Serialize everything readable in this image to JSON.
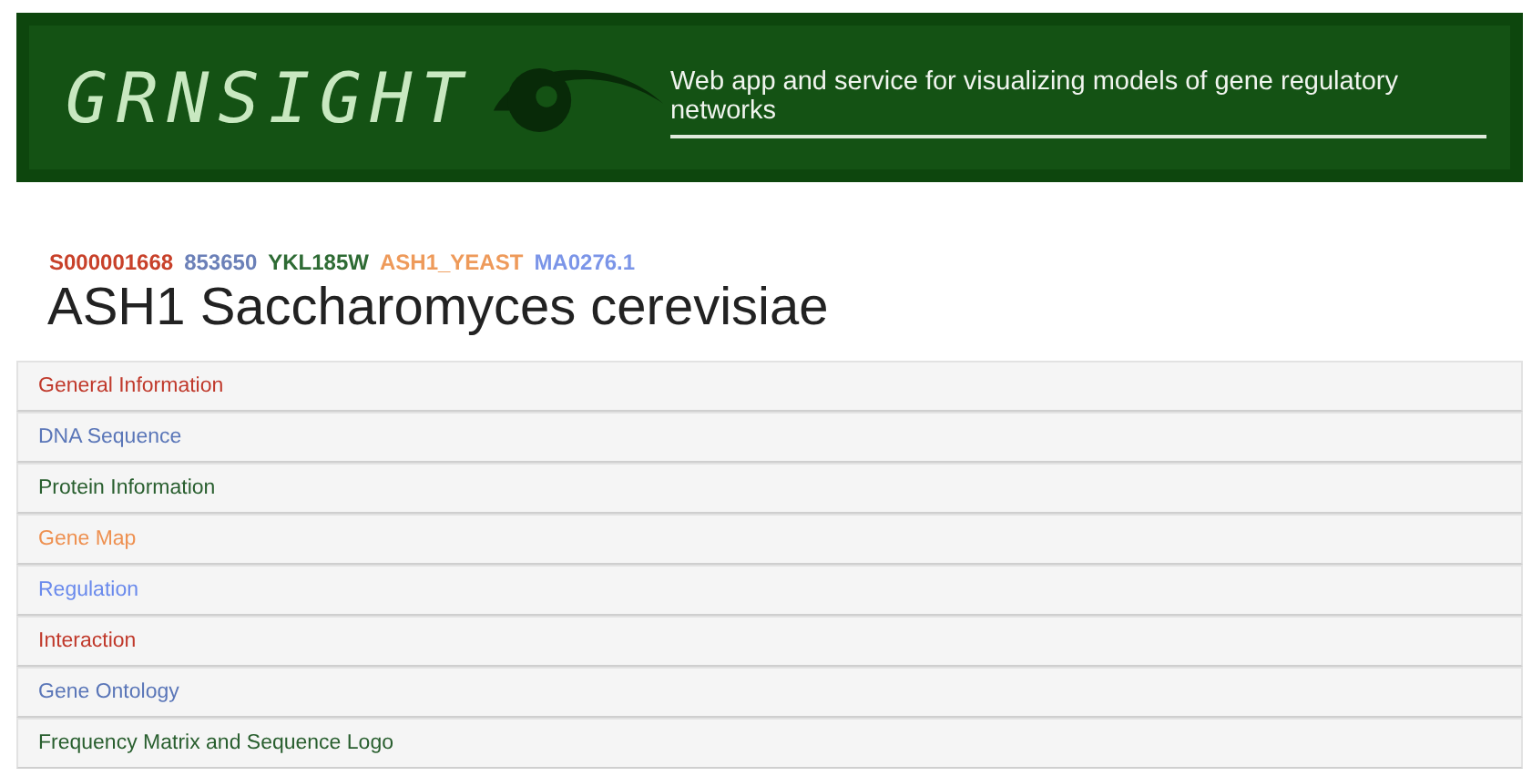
{
  "banner": {
    "logo": "GRNSIGHT",
    "tagline": "Web app and service for visualizing models of gene regulatory networks"
  },
  "identifiers": [
    {
      "text": "S000001668",
      "color": "#c8412a"
    },
    {
      "text": "853650",
      "color": "#6b80b8"
    },
    {
      "text": "YKL185W",
      "color": "#2e6b34"
    },
    {
      "text": "ASH1_YEAST",
      "color": "#ee9a5a"
    },
    {
      "text": "MA0276.1",
      "color": "#7b95e8"
    }
  ],
  "title": "ASH1 Saccharomyces cerevisiae",
  "sections": [
    {
      "label": "General Information",
      "color": "#c0392b"
    },
    {
      "label": "DNA Sequence",
      "color": "#5a76b8"
    },
    {
      "label": "Protein Information",
      "color": "#285e2e"
    },
    {
      "label": "Gene Map",
      "color": "#ee9050"
    },
    {
      "label": "Regulation",
      "color": "#6a8aec"
    },
    {
      "label": "Interaction",
      "color": "#c0392b"
    },
    {
      "label": "Gene Ontology",
      "color": "#5a76b8"
    },
    {
      "label": "Frequency Matrix and Sequence Logo",
      "color": "#285e2e"
    }
  ]
}
